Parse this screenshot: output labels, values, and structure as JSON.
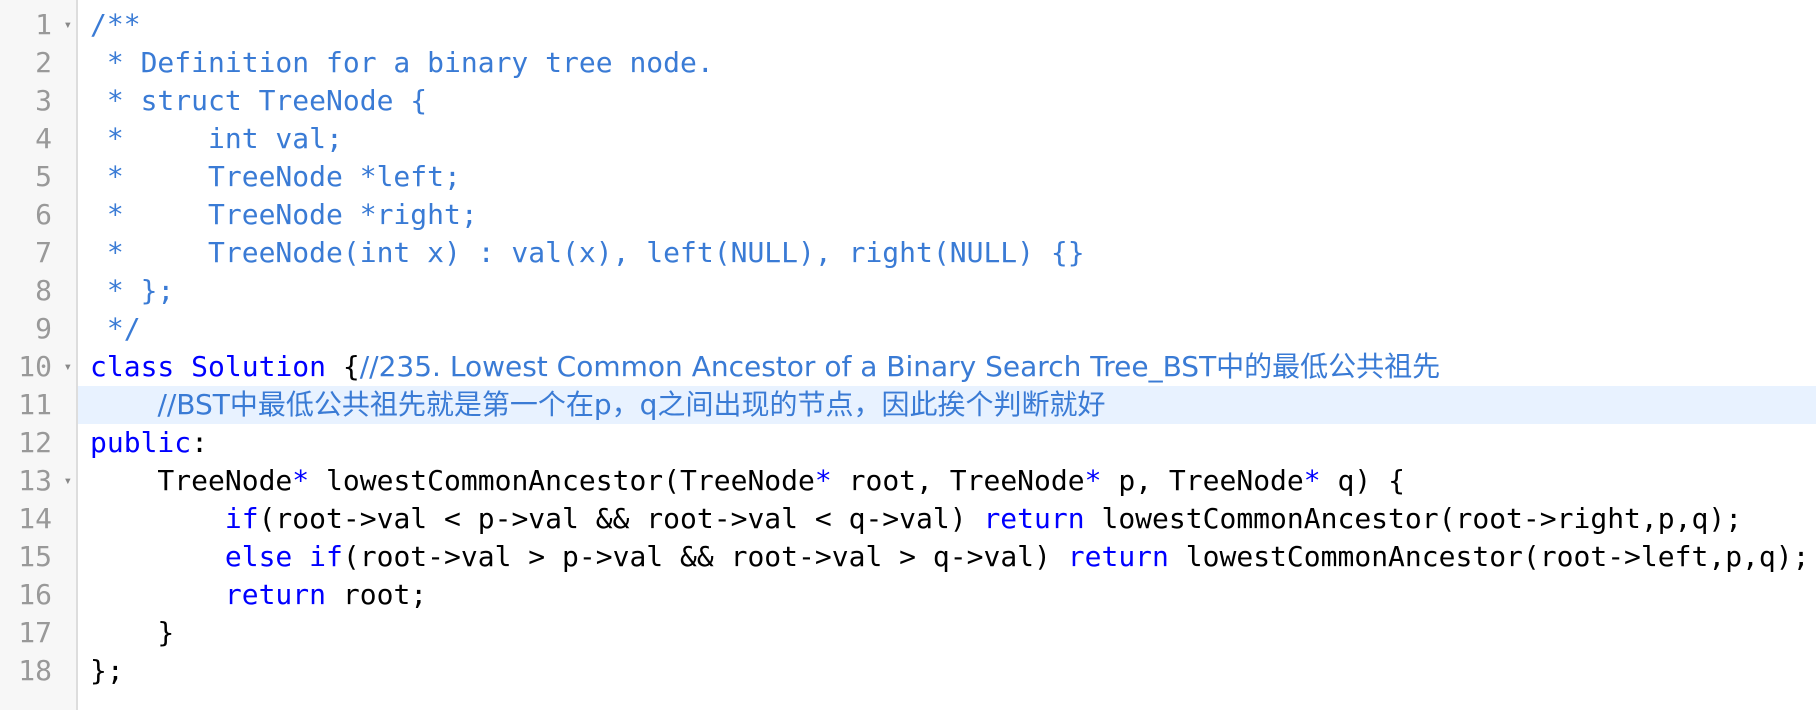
{
  "editor": {
    "colors": {
      "comment": "#3a7bd5",
      "keyword": "#0000ff",
      "text": "#000000",
      "gutter_bg": "#f7f7f7",
      "gutter_text": "#999999",
      "active_line": "#e8f2ff"
    },
    "gutter": {
      "line_numbers": [
        "1",
        "2",
        "3",
        "4",
        "5",
        "6",
        "7",
        "8",
        "9",
        "10",
        "11",
        "12",
        "13",
        "14",
        "15",
        "16",
        "17",
        "18"
      ],
      "fold_icon": "▾"
    },
    "lines": [
      {
        "text": "/**"
      },
      {
        "text": " * Definition for a binary tree node."
      },
      {
        "text": " * struct TreeNode {"
      },
      {
        "text": " *     int val;"
      },
      {
        "text": " *     TreeNode *left;"
      },
      {
        "text": " *     TreeNode *right;"
      },
      {
        "text": " *     TreeNode(int x) : val(x), left(NULL), right(NULL) {}"
      },
      {
        "text": " * };"
      },
      {
        "text": " */"
      },
      {
        "prefix_kw": "class",
        "mid": " Solution ",
        "brace": "{",
        "comment": "//235. Lowest Common Ancestor of a Binary Search Tree_BST中的最低公共祖先"
      },
      {
        "indent": "    ",
        "comment": "//BST中最低公共祖先就是第一个在p，q之间出现的节点，因此挨个判断就好"
      },
      {
        "kw": "public",
        "tail": ":"
      },
      {
        "part1": "    TreeNode",
        "op1": "*",
        "part2": " lowestCommonAncestor(TreeNode",
        "op2": "*",
        "part3": " root, TreeNode",
        "op3": "*",
        "part4": " p, TreeNode",
        "op4": "*",
        "part5": " q) {"
      },
      {
        "indent": "        ",
        "kw": "if",
        "body": "(root->val < p->val && root->val < q->val) ",
        "kw2": "return",
        "tail": " lowestCommonAncestor(root->right,p,q);"
      },
      {
        "indent": "        ",
        "kw": "else if",
        "body": "(root->val > p->val && root->val > q->val) ",
        "kw2": "return",
        "tail": " lowestCommonAncestor(root->left,p,q);"
      },
      {
        "indent": "        ",
        "kw": "return",
        "tail": " root;"
      },
      {
        "text": "    }"
      },
      {
        "text": "};"
      }
    ]
  }
}
